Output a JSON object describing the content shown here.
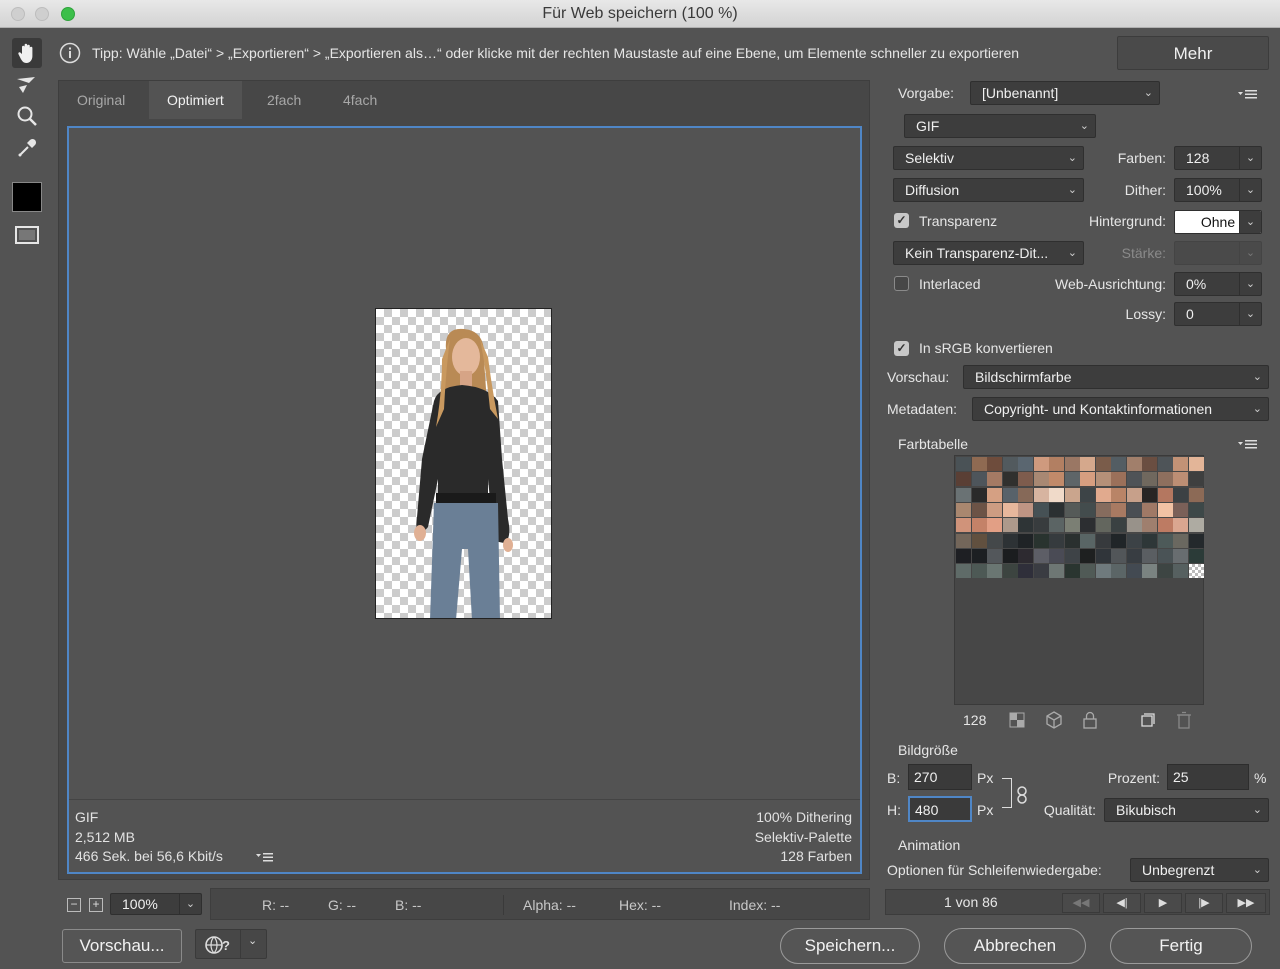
{
  "window": {
    "title": "Für Web speichern (100 %)"
  },
  "colors": {
    "accent": "#4f86c6",
    "foreground": "#000000"
  },
  "tools": [
    {
      "icon": "hand-icon"
    },
    {
      "icon": "slice-select-icon"
    },
    {
      "icon": "zoom-icon"
    },
    {
      "icon": "eyedropper-icon"
    },
    {
      "icon": "eyedropper-color-swatch"
    },
    {
      "icon": "toggle-slices-icon"
    }
  ],
  "tip": {
    "icon": "info-icon",
    "text": "Tipp: Wähle „Datei“ > „Exportieren“ > „Exportieren als…“ oder klicke mit der rechten Maustaste auf eine Ebene, um Elemente schneller zu exportieren"
  },
  "more_button": "Mehr",
  "tabs": [
    {
      "label": "Original",
      "active": false
    },
    {
      "label": "Optimiert",
      "active": true
    },
    {
      "label": "2fach",
      "active": false
    },
    {
      "label": "4fach",
      "active": false
    }
  ],
  "preview_info": {
    "left": [
      "GIF",
      "2,512 MB",
      "466 Sek. bei 56,6 Kbit/s"
    ],
    "right": [
      "100% Dithering",
      "Selektiv-Palette",
      "128 Farben"
    ]
  },
  "status": {
    "zoom": "100%",
    "r": "R: --",
    "g": "G: --",
    "b": "B: --",
    "alpha": "Alpha: --",
    "hex": "Hex: --",
    "index": "Index: --"
  },
  "settings": {
    "preset_label": "Vorgabe:",
    "preset_value": "[Unbenannt]",
    "format": "GIF",
    "reduction": "Selektiv",
    "colors_label": "Farben:",
    "colors_value": "128",
    "dither_algo": "Diffusion",
    "dither_label": "Dither:",
    "dither_value": "100%",
    "transparency_label": "Transparenz",
    "transparency_checked": true,
    "matte_label": "Hintergrund:",
    "matte_value": "Ohne",
    "transp_dither": "Kein Transparenz-Dit...",
    "amount_label": "Stärke:",
    "interlaced_label": "Interlaced",
    "interlaced_checked": false,
    "websnap_label": "Web-Ausrichtung:",
    "websnap_value": "0%",
    "lossy_label": "Lossy:",
    "lossy_value": "0",
    "srgb_label": "In sRGB konvertieren",
    "srgb_checked": true,
    "preview_label": "Vorschau:",
    "preview_value": "Bildschirmfarbe",
    "metadata_label": "Metadaten:",
    "metadata_value": "Copyright- und Kontaktinformationen"
  },
  "color_table": {
    "title": "Farbtabelle",
    "count": "128",
    "swatches": [
      "#4a5256",
      "#8f6a52",
      "#6e4c3c",
      "#525a5e",
      "#5a6670",
      "#cf9a7e",
      "#b27f62",
      "#9a7764",
      "#d5a88c",
      "#7a5c4a",
      "#535d63",
      "#a17f6b",
      "#6a4e41",
      "#4e5458",
      "#c29276",
      "#e3b598",
      "#5a3f35",
      "#4e555b",
      "#a47a64",
      "#30302e",
      "#7e5c4d",
      "#a88873",
      "#c18a6a",
      "#5e6568",
      "#d69e80",
      "#b59078",
      "#9b705a",
      "#4f5357",
      "#70685e",
      "#8e6f5e",
      "#bd8e74",
      "#3e3f3f",
      "#6a7274",
      "#2a2a2a",
      "#d5a083",
      "#58626a",
      "#866958",
      "#d7b4a0",
      "#f0dac9",
      "#caa58d",
      "#3d4447",
      "#e1aa8e",
      "#b98467",
      "#c7a08a",
      "#282524",
      "#b47760",
      "#3c4144",
      "#8c6a56",
      "#a9876f",
      "#6c5346",
      "#cd9c82",
      "#e7b79c",
      "#bf9584",
      "#465155",
      "#2b3032",
      "#555a58",
      "#434c4d",
      "#866c5e",
      "#a87a62",
      "#4a4e53",
      "#a07966",
      "#f2c2a4",
      "#7b6058",
      "#3d4848",
      "#d0937a",
      "#c48268",
      "#e29f85",
      "#ad998b",
      "#2e3436",
      "#383c3e",
      "#5b6464",
      "#7b7f74",
      "#2c2e31",
      "#63665e",
      "#3a4142",
      "#98928a",
      "#9f7f6e",
      "#bd7b63",
      "#daa690",
      "#aeaba2",
      "#73665a",
      "#61503f",
      "#44484a",
      "#2d3235",
      "#1f2326",
      "#29332f",
      "#363b3e",
      "#2a302f",
      "#596565",
      "#373a3d",
      "#202528",
      "#3c4246",
      "#2e3738",
      "#4d5a59",
      "#6a6860",
      "#24292c",
      "#1e1f23",
      "#1c1f22",
      "#53575b",
      "#1b1d1f",
      "#2d2a30",
      "#5d5e66",
      "#4a4b55",
      "#3e4347",
      "#1e2020",
      "#30353a",
      "#525659",
      "#383d42",
      "#5a5e62",
      "#4a5356",
      "#686d70",
      "#2b3b38",
      "#5f6b68",
      "#4d5955",
      "#6a7672",
      "#3c4440",
      "#2f2f3a",
      "#3a3c42",
      "#6e7774",
      "#2a3530",
      "#505a56",
      "#6f7a7d",
      "#5b6566",
      "#434a52",
      "#7a8381",
      "#3d4543",
      "#566060",
      "transparent"
    ]
  },
  "image_size": {
    "title": "Bildgröße",
    "w_label": "B:",
    "w_value": "270",
    "h_label": "H:",
    "h_value": "480",
    "unit": "Px",
    "percent_label": "Prozent:",
    "percent_value": "25",
    "percent_unit": "%",
    "quality_label": "Qualität:",
    "quality_value": "Bikubisch"
  },
  "animation": {
    "title": "Animation",
    "loop_label": "Optionen für Schleifenwiedergabe:",
    "loop_value": "Unbegrenzt",
    "frame_counter": "1 von 86"
  },
  "footer": {
    "preview_button": "Vorschau...",
    "browser_icon": "browser-icon",
    "save_button": "Speichern...",
    "cancel_button": "Abbrechen",
    "done_button": "Fertig"
  }
}
